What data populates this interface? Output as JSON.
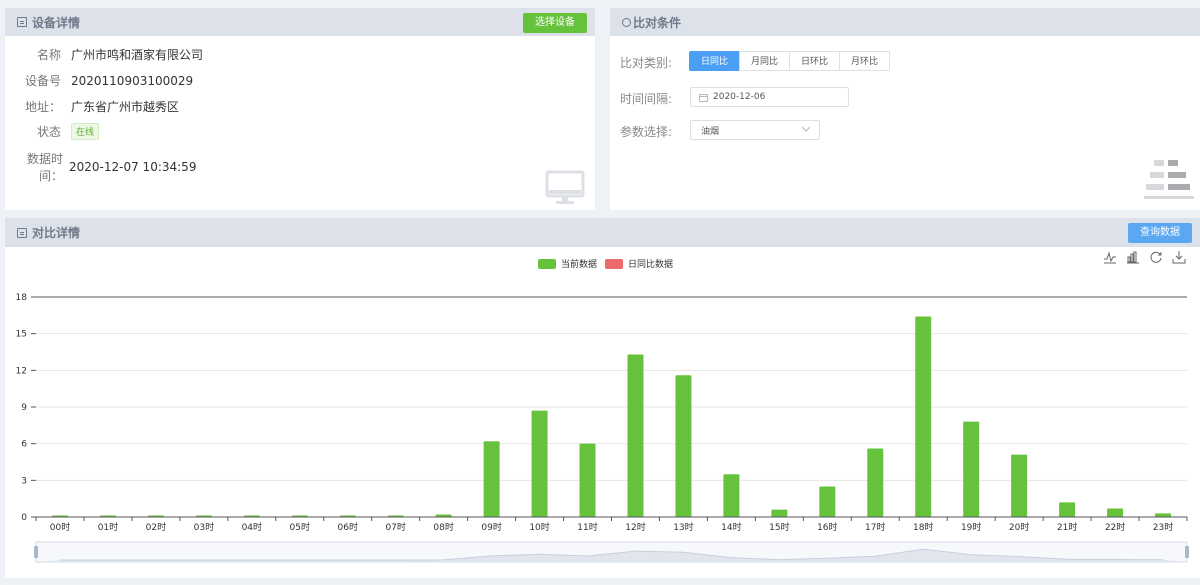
{
  "device": {
    "title": "设备详情",
    "select_button": "选择设备",
    "rows": [
      {
        "label": "名称",
        "value": "广州市鸣和酒家有限公司"
      },
      {
        "label": "设备号",
        "value": "2020110903100029"
      },
      {
        "label": "地址：",
        "value": "广东省广州市越秀区"
      },
      {
        "label": "状态",
        "value": "在线"
      },
      {
        "label": "数据时间：",
        "value": "2020-12-07 10:34:59"
      }
    ]
  },
  "compare": {
    "title": "比对条件",
    "type_label": "比对类别:",
    "types": [
      "日同比",
      "月同比",
      "日环比",
      "月环比"
    ],
    "active_type": "日同比",
    "interval_label": "时间间隔:",
    "interval_value": "2020-12-06",
    "param_label": "参数选择:",
    "param_value": "油烟"
  },
  "detail": {
    "title": "对比详情",
    "query_button": "查询数据"
  },
  "colors": {
    "current": "#66c23a",
    "compare": "#ee6b6b",
    "active_blue": "#4a9ff5"
  },
  "chart_data": {
    "type": "bar",
    "legend": [
      "当前数据",
      "日同比数据"
    ],
    "categories": [
      "00时",
      "01时",
      "02时",
      "03时",
      "04时",
      "05时",
      "06时",
      "07时",
      "08时",
      "09时",
      "10时",
      "11时",
      "12时",
      "13时",
      "14时",
      "15时",
      "16时",
      "17时",
      "18时",
      "19时",
      "20时",
      "21时",
      "22时",
      "23时"
    ],
    "series": [
      {
        "name": "当前数据",
        "values": [
          0.05,
          0.05,
          0.05,
          0.05,
          0.05,
          0.05,
          0.05,
          0.05,
          0.2,
          6.2,
          8.7,
          6.0,
          13.3,
          11.6,
          3.5,
          0.6,
          2.5,
          5.6,
          16.4,
          7.8,
          5.1,
          1.2,
          0.7,
          0.3
        ]
      },
      {
        "name": "日同比数据",
        "values": []
      }
    ],
    "y_ticks": [
      0,
      3,
      6,
      9,
      12,
      15,
      18
    ],
    "ylim": [
      0,
      18
    ],
    "grid": true,
    "legend_position": "top-center"
  }
}
